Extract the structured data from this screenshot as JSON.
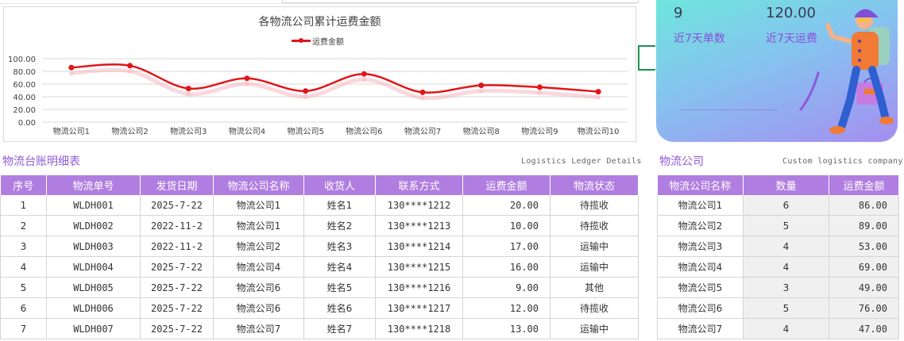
{
  "chart_data": {
    "type": "line",
    "title": "各物流公司累计运费金额",
    "categories": [
      "物流公司1",
      "物流公司2",
      "物流公司3",
      "物流公司4",
      "物流公司5",
      "物流公司6",
      "物流公司7",
      "物流公司8",
      "物流公司9",
      "物流公司10"
    ],
    "series": [
      {
        "name": "运费金额",
        "values": [
          86,
          89,
          53,
          69,
          49,
          76,
          47,
          58,
          55,
          48
        ]
      }
    ],
    "ylim": [
      0,
      100
    ],
    "yticks": [
      "100.00",
      "80.00",
      "60.00",
      "40.00",
      "20.00",
      "0.00"
    ],
    "grid": true,
    "legend": "top-center",
    "line_color": "#e0161a"
  },
  "stats": {
    "orders_value": "9",
    "orders_label": "近7天单数",
    "freight_value": "120.00",
    "freight_label": "近7天运费"
  },
  "ledger": {
    "title": "物流台账明细表",
    "subtitle": "Logistics Ledger Details",
    "headers": [
      "序号",
      "物流单号",
      "发货日期",
      "物流公司名称",
      "收货人",
      "联系方式",
      "运费金额",
      "物流状态"
    ],
    "rows": [
      [
        "1",
        "WLDH001",
        "2025-7-22",
        "物流公司1",
        "姓名1",
        "130****1212",
        "20.00",
        "待揽收"
      ],
      [
        "2",
        "WLDH002",
        "2022-11-2",
        "物流公司1",
        "姓名2",
        "130****1213",
        "10.00",
        "待揽收"
      ],
      [
        "3",
        "WLDH003",
        "2022-11-2",
        "物流公司2",
        "姓名3",
        "130****1214",
        "17.00",
        "运输中"
      ],
      [
        "4",
        "WLDH004",
        "2025-7-22",
        "物流公司4",
        "姓名4",
        "130****1215",
        "16.00",
        "运输中"
      ],
      [
        "5",
        "WLDH005",
        "2025-7-22",
        "物流公司6",
        "姓名5",
        "130****1216",
        "9.00",
        "其他"
      ],
      [
        "6",
        "WLDH006",
        "2025-7-22",
        "物流公司6",
        "姓名6",
        "130****1217",
        "12.00",
        "待揽收"
      ],
      [
        "7",
        "WLDH007",
        "2025-7-22",
        "物流公司7",
        "姓名7",
        "130****1218",
        "13.00",
        "运输中"
      ]
    ]
  },
  "companies": {
    "title": "物流公司",
    "subtitle": "Custom logistics company",
    "headers": [
      "物流公司名称",
      "数量",
      "运费金额"
    ],
    "rows": [
      [
        "物流公司1",
        "6",
        "86.00"
      ],
      [
        "物流公司2",
        "5",
        "89.00"
      ],
      [
        "物流公司3",
        "4",
        "53.00"
      ],
      [
        "物流公司4",
        "4",
        "69.00"
      ],
      [
        "物流公司5",
        "3",
        "49.00"
      ],
      [
        "物流公司6",
        "5",
        "76.00"
      ],
      [
        "物流公司7",
        "4",
        "47.00"
      ]
    ]
  },
  "colors": {
    "accent": "#b07ee0",
    "title_purple": "#8f5bd6",
    "line_red": "#e0161a"
  },
  "illustration": "delivery-courier-icon"
}
